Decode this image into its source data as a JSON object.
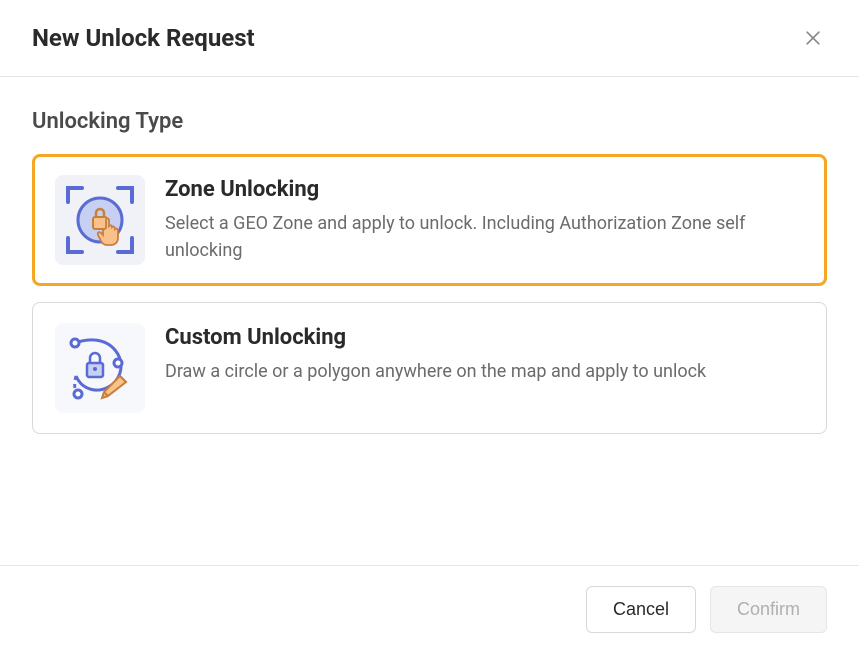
{
  "dialog": {
    "title": "New Unlock Request",
    "section_title": "Unlocking Type",
    "options": [
      {
        "title": "Zone Unlocking",
        "description": "Select a GEO Zone and apply to unlock. Including Authorization Zone self unlocking",
        "selected": true
      },
      {
        "title": "Custom Unlocking",
        "description": "Draw a circle or a polygon anywhere on the map and apply to unlock",
        "selected": false
      }
    ],
    "buttons": {
      "cancel": "Cancel",
      "confirm": "Confirm"
    }
  }
}
